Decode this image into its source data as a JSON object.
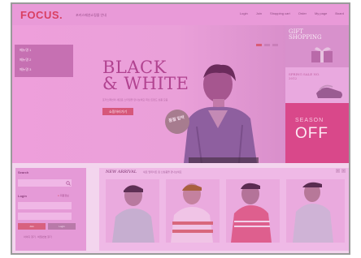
{
  "header": {
    "logo": "FOCUS.",
    "logo_sub": "포커스패션쇼핑몰 안내",
    "nav": [
      "Login",
      "Join",
      "Shopping cart",
      "Order",
      "My page",
      "Board"
    ]
  },
  "hero": {
    "menu": [
      "메뉴명 1",
      "메뉴명 2",
      "메뉴명 3"
    ],
    "title_line1": "BLACK",
    "title_line2": "& WHITE",
    "description": "포커스패션의 새로운 스타일을 만나보세요 최신 트렌드 상품 모음",
    "button": "쇼핑하러가기",
    "badge": "품절 임박"
  },
  "promos": {
    "gift_line1": "GIFT",
    "gift_line2": "SHOPPING",
    "spring_line1": "SPRING SALE NO.",
    "spring_line2": "2012",
    "season": "SEASON",
    "off": "OFF"
  },
  "login": {
    "search_label": "Search",
    "login_label": "Login",
    "save_id": "회원정보",
    "join_button": "Join",
    "login_button": "Login",
    "links": "아이디 찾기 · 비밀번호 찾기"
  },
  "arrivals": {
    "title": "NEW ARRIVAL",
    "subtitle": "새로 업데이트 된 신상품을 만나보세요",
    "prev": "‹",
    "next": "›"
  },
  "colors": {
    "accent": "#d93f62",
    "overlay": "#e99ad8"
  }
}
